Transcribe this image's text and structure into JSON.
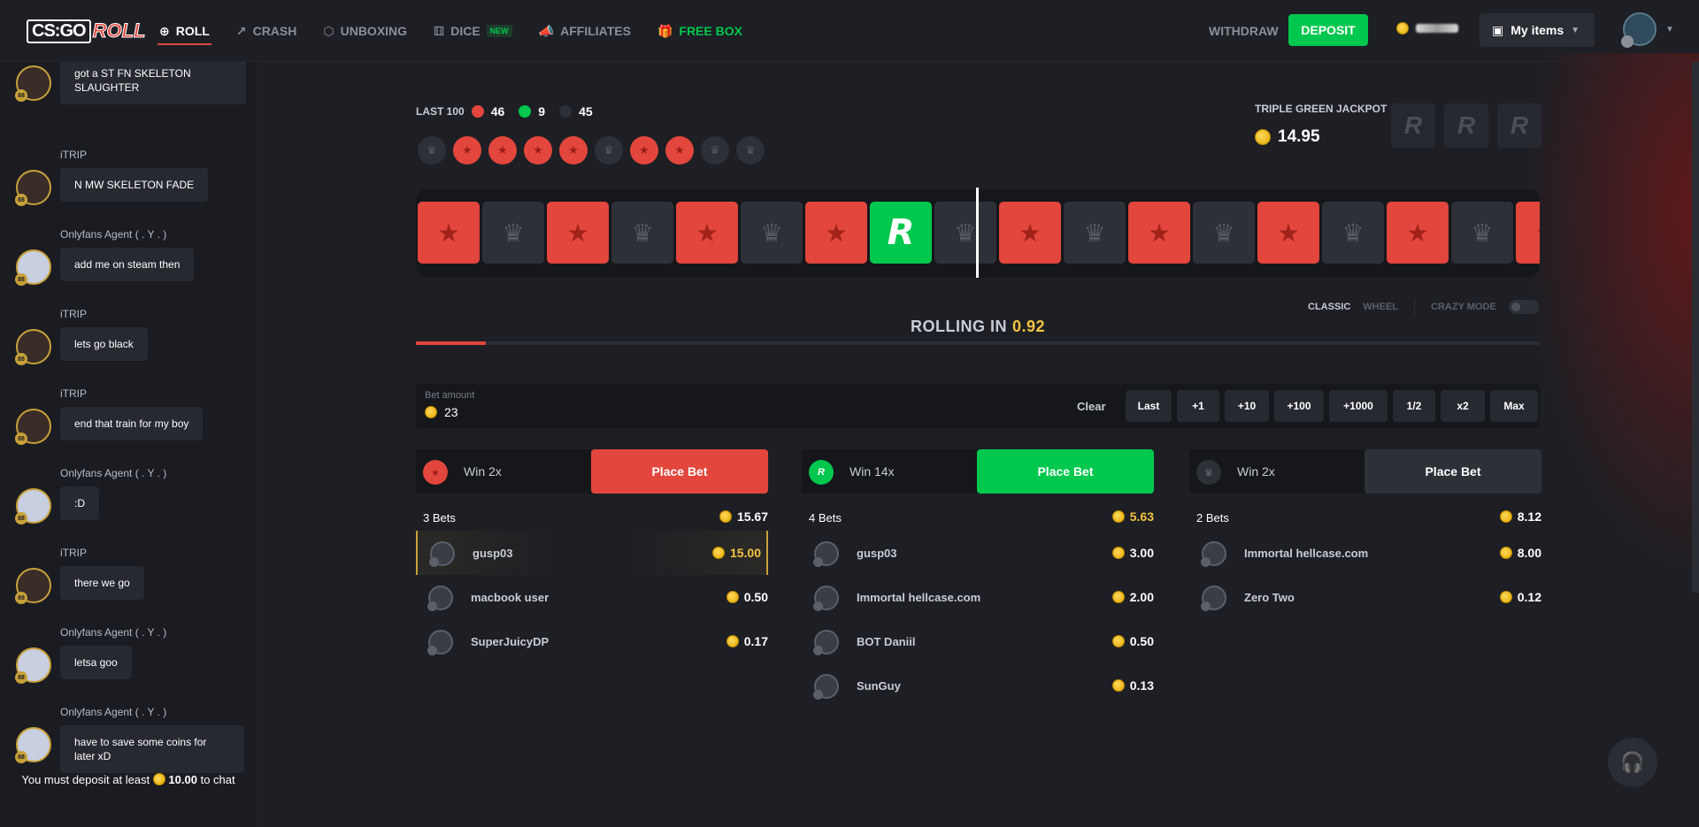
{
  "nav": {
    "logo_cs": "CS:GO",
    "logo_roll": "ROLL",
    "items": [
      {
        "label": "ROLL",
        "icon": "crosshair-icon",
        "glyph": "⊕"
      },
      {
        "label": "CRASH",
        "icon": "chart-icon",
        "glyph": "↗"
      },
      {
        "label": "UNBOXING",
        "icon": "box-icon",
        "glyph": "⬡"
      },
      {
        "label": "DICE",
        "icon": "dice-icon",
        "glyph": "⚅",
        "badge": "NEW"
      },
      {
        "label": "AFFILIATES",
        "icon": "megaphone-icon",
        "glyph": "📣"
      },
      {
        "label": "FREE BOX",
        "icon": "gift-icon",
        "glyph": "🎁"
      }
    ],
    "withdraw": "WITHDRAW",
    "deposit": "DEPOSIT",
    "my_items": "My items"
  },
  "chat": {
    "messages": [
      {
        "name": "",
        "text": "got a ST FN SKELETON SLAUGHTER",
        "avatar": "girl"
      },
      {
        "name": "iTRIP",
        "text": "N MW SKELETON FADE",
        "avatar": "girl"
      },
      {
        "name": "Onlyfans Agent ( . Y . )",
        "text": "add me on steam then",
        "avatar": "clown"
      },
      {
        "name": "iTRIP",
        "text": "lets go black",
        "avatar": "girl"
      },
      {
        "name": "iTRIP",
        "text": "end that train for my boy",
        "avatar": "girl"
      },
      {
        "name": "Onlyfans Agent ( . Y . )",
        "text": ":D",
        "avatar": "clown"
      },
      {
        "name": "iTRIP",
        "text": "there we go",
        "avatar": "girl"
      },
      {
        "name": "Onlyfans Agent ( . Y . )",
        "text": "letsa goo",
        "avatar": "clown"
      },
      {
        "name": "Onlyfans Agent ( . Y . )",
        "text": "have to save some coins for later xD",
        "avatar": "clown"
      }
    ],
    "level": "88",
    "footer_pre": "You must deposit at least",
    "footer_amount": "10.00",
    "footer_post": "to chat"
  },
  "game": {
    "last100_label": "LAST 100",
    "counts": {
      "red": "46",
      "green": "9",
      "dark": "45"
    },
    "history": [
      "dark",
      "red",
      "red",
      "red",
      "red",
      "dark",
      "red",
      "red",
      "dark",
      "dark"
    ],
    "jackpot_label": "TRIPLE GREEN JACKPOT",
    "jackpot_value": "14.95",
    "roller": [
      "red",
      "dark",
      "red",
      "dark",
      "red",
      "dark",
      "red",
      "green",
      "dark",
      "red",
      "dark",
      "red",
      "dark",
      "red",
      "dark",
      "red",
      "dark",
      "red"
    ],
    "mode_classic": "CLASSIC",
    "mode_wheel": "WHEEL",
    "crazy_mode": "CRAZY MODE",
    "rolling_label": "ROLLING IN",
    "rolling_time": "0.92",
    "progress_fraction": 0.062
  },
  "bet": {
    "label": "Bet amount",
    "amount": "23",
    "clear": "Clear",
    "quick": [
      "Last",
      "+1",
      "+10",
      "+100",
      "+1000",
      "1/2",
      "x2",
      "Max"
    ]
  },
  "columns": [
    {
      "color": "#e2463c",
      "win": "Win 2x",
      "place": "Place Bet",
      "count": "3 Bets",
      "total": "15.67",
      "rows": [
        {
          "name": "gusp03",
          "amount": "15.00",
          "hl": true
        },
        {
          "name": "macbook user",
          "amount": "0.50"
        },
        {
          "name": "SuperJuicyDP",
          "amount": "0.17"
        }
      ]
    },
    {
      "color": "#00c74d",
      "win": "Win 14x",
      "place": "Place Bet",
      "count": "4 Bets",
      "total": "5.63",
      "rows": [
        {
          "name": "gusp03",
          "amount": "3.00"
        },
        {
          "name": "Immortal hellcase.com",
          "amount": "2.00"
        },
        {
          "name": "BOT Daniil",
          "amount": "0.50"
        },
        {
          "name": "SunGuy",
          "amount": "0.13"
        }
      ]
    },
    {
      "color": "#2d3037",
      "win": "Win 2x",
      "place": "Place Bet",
      "count": "2 Bets",
      "total": "8.12",
      "rows": [
        {
          "name": "Immortal hellcase.com",
          "amount": "8.00"
        },
        {
          "name": "Zero Two",
          "amount": "0.12"
        }
      ]
    }
  ]
}
